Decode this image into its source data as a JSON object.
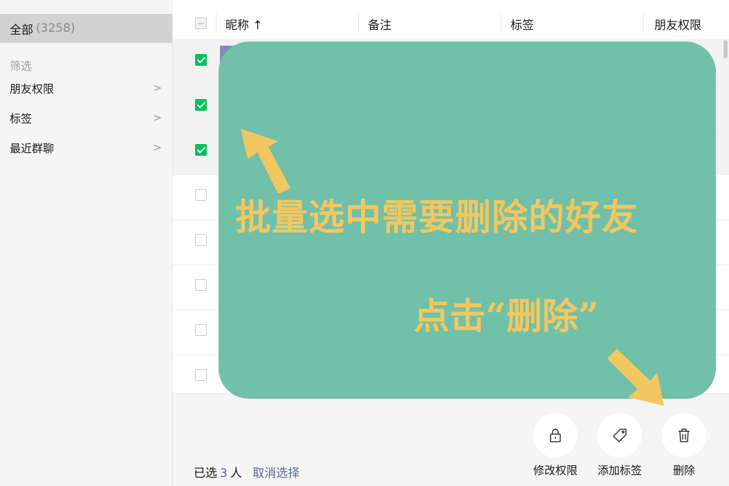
{
  "sidebar": {
    "all_label": "全部",
    "all_count": "(3258)",
    "filter_heading": "筛选",
    "items": [
      {
        "label": "朋友权限",
        "chevron": ">"
      },
      {
        "label": "标签",
        "chevron": ">"
      },
      {
        "label": "最近群聊",
        "chevron": ">"
      }
    ]
  },
  "header": {
    "columns": [
      "昵称 ↑",
      "备注",
      "标签",
      "朋友权限"
    ]
  },
  "rows": [
    {
      "checked": true
    },
    {
      "checked": true
    },
    {
      "checked": true
    },
    {
      "checked": false
    },
    {
      "checked": false
    },
    {
      "checked": false
    },
    {
      "checked": false
    },
    {
      "checked": false
    }
  ],
  "footer": {
    "selected_prefix": "已选",
    "selected_count": "3",
    "selected_suffix": "人",
    "cancel_label": "取消选择",
    "actions": [
      {
        "label": "修改权限",
        "icon": "lock-icon"
      },
      {
        "label": "添加标签",
        "icon": "tag-icon"
      },
      {
        "label": "删除",
        "icon": "trash-icon"
      }
    ]
  },
  "annotation": {
    "line1": "批量选中需要删除的好友",
    "line2": "点击“删除”",
    "bg_color": "#71c0a9",
    "text_color": "#f3c75f"
  },
  "colors": {
    "accent_green": "#07c160",
    "link_blue": "#576b95"
  }
}
